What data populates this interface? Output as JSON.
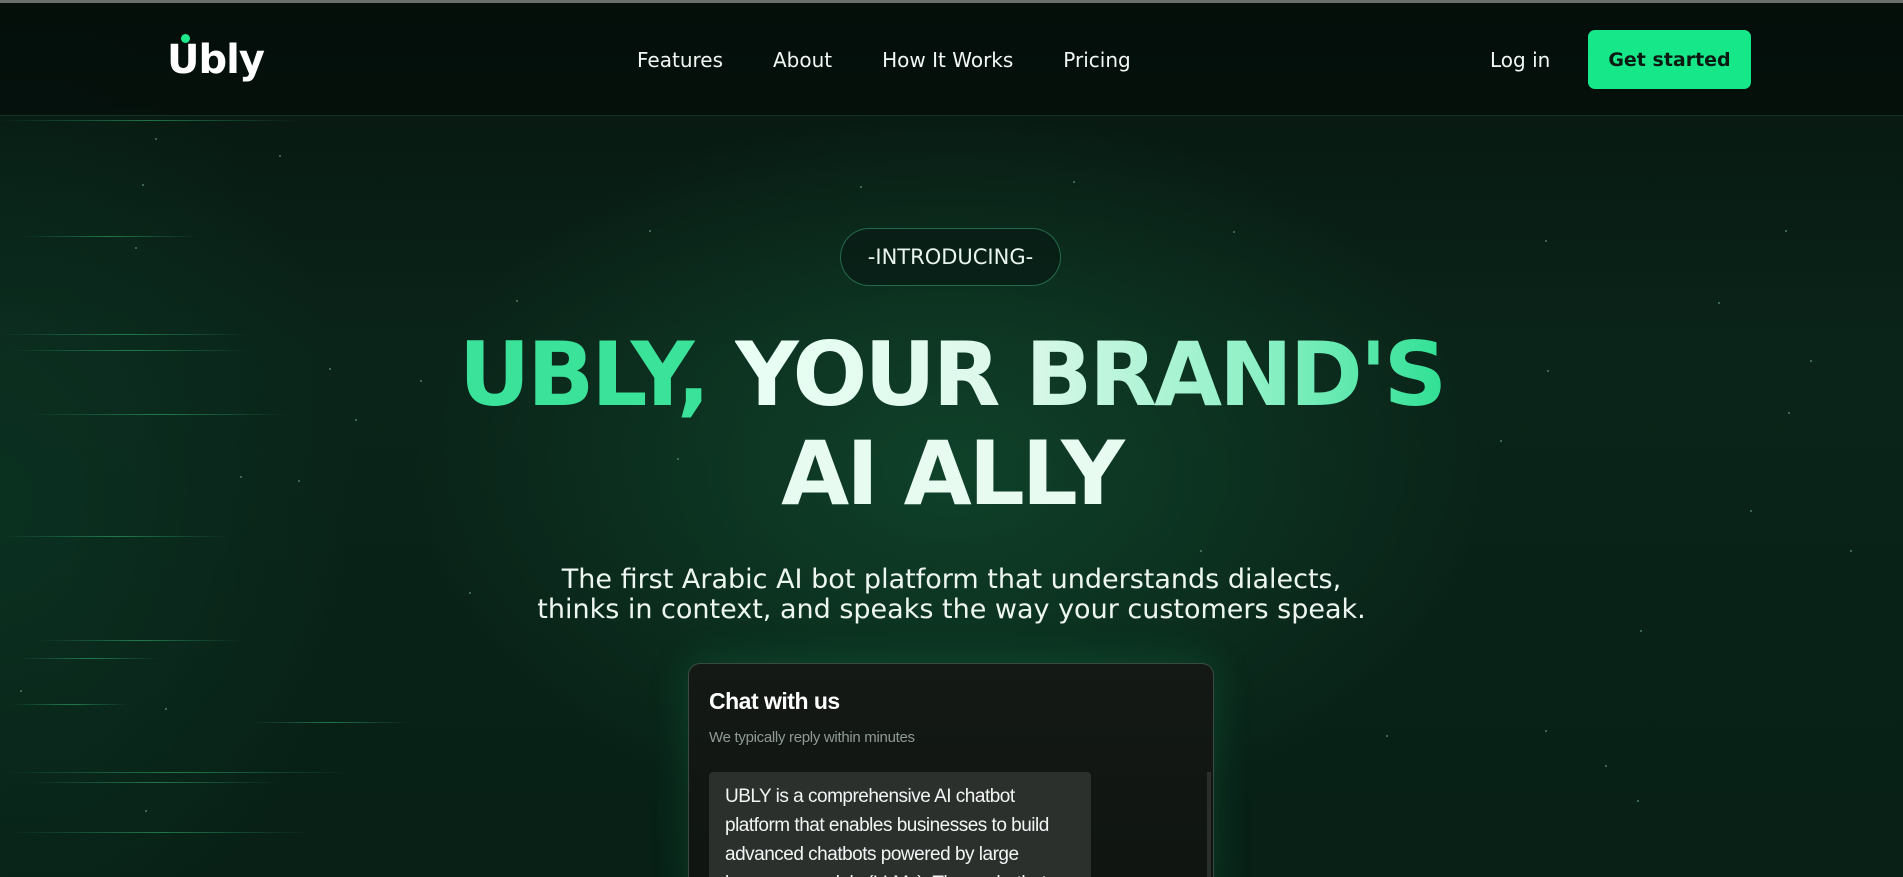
{
  "brand": {
    "logo_text": "Ubly",
    "accent": "#16e889"
  },
  "nav": {
    "items": [
      "Features",
      "About",
      "How It Works",
      "Pricing"
    ],
    "login_label": "Log in",
    "cta_label": "Get started"
  },
  "hero": {
    "eyebrow": "-INTRODUCING-",
    "headline_part1": "UBLY,",
    "headline_part2": "YOUR BRAND'S",
    "headline_line2": "AI ALLY",
    "subtitle_line1": "The first Arabic AI bot platform that understands dialects,",
    "subtitle_line2": "thinks in context, and speaks the way your customers speak."
  },
  "chat": {
    "title": "Chat with us",
    "subtitle": "We typically reply within minutes",
    "message": "UBLY is a comprehensive AI chatbot platform that enables businesses to build advanced chatbots powered by large language models (LLMs). These chatbots"
  }
}
